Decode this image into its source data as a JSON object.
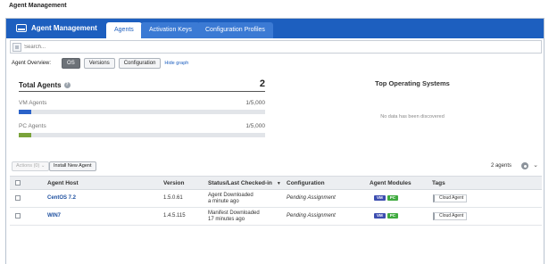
{
  "page": {
    "title": "Agent Management"
  },
  "app": {
    "title": "Agent Management",
    "tabs": [
      {
        "label": "Agents",
        "active": true
      },
      {
        "label": "Activation Keys",
        "active": false
      },
      {
        "label": "Configuration Profiles",
        "active": false
      }
    ]
  },
  "search": {
    "placeholder": "Search..."
  },
  "overview": {
    "label": "Agent Overview:",
    "buttons": [
      {
        "label": "OS",
        "active": true
      },
      {
        "label": "Versions",
        "active": false
      },
      {
        "label": "Configuration",
        "active": false
      }
    ],
    "hide_graph": "Hide graph"
  },
  "totals": {
    "title": "Total Agents",
    "count": "2",
    "metrics": [
      {
        "label": "VM Agents",
        "value": "1/5,000",
        "fraction": 0.05,
        "color": "#2b63c9"
      },
      {
        "label": "PC Agents",
        "value": "1/5,000",
        "fraction": 0.05,
        "color": "#7aa33a"
      }
    ]
  },
  "top_os": {
    "title": "Top Operating Systems",
    "empty": "No data has been discovered"
  },
  "actions": {
    "actions_label": "Actions (0) ⌄",
    "install_label": "Install New Agent",
    "agent_count": "2 agents"
  },
  "table": {
    "headers": {
      "host": "Agent Host",
      "version": "Version",
      "status": "Status/Last Checked-in",
      "configuration": "Configuration",
      "modules": "Agent Modules",
      "tags": "Tags"
    },
    "rows": [
      {
        "host": "CentOS 7.2",
        "version": "1.5.0.61",
        "status": "Agent Downloaded",
        "checked": "a minute ago",
        "configuration": "Pending Assignment",
        "module_vm": "VM",
        "module_pc": "PC",
        "tag": "Cloud Agent"
      },
      {
        "host": "WIN7",
        "version": "1.4.5.115",
        "status": "Manifest Downloaded",
        "checked": "17 minutes ago",
        "configuration": "Pending Assignment",
        "module_vm": "VM",
        "module_pc": "PC",
        "tag": "Cloud Agent"
      }
    ]
  },
  "colors": {
    "brand_blue": "#1d5fbf",
    "vm_badge": "#3d4eb0",
    "pc_badge": "#3faa3f"
  }
}
